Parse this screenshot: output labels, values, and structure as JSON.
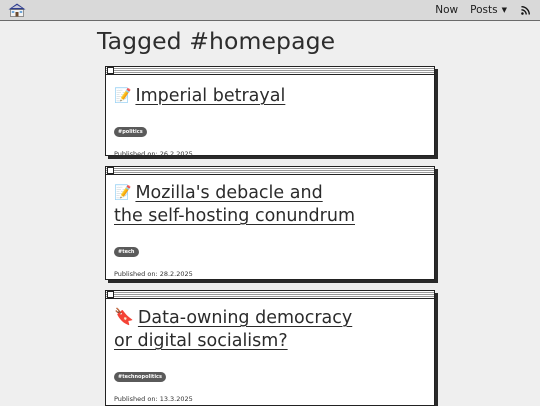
{
  "header": {
    "logo_icon": "house-icon",
    "nav": {
      "now_label": "Now",
      "posts_label": "Posts",
      "posts_caret": "▼",
      "rss_icon": "rss-icon"
    }
  },
  "page": {
    "title": "Tagged #homepage"
  },
  "posts": [
    {
      "emoji_icon": "memo-icon",
      "title_line1": "Imperial betrayal",
      "title_line2": "",
      "tag": "#politics",
      "published": "Published on: 26.2.2025"
    },
    {
      "emoji_icon": "memo-icon",
      "title_line1": "Mozilla's debacle and",
      "title_line2": "the self-hosting conundrum",
      "tag": "#tech",
      "published": "Published on: 28.2.2025"
    },
    {
      "emoji_icon": "bookmark-icon",
      "title_line1": "Data-owning democracy",
      "title_line2": "or digital socialism?",
      "tag": "#technopolitics",
      "published": "Published on: 13.3.2025"
    }
  ]
}
